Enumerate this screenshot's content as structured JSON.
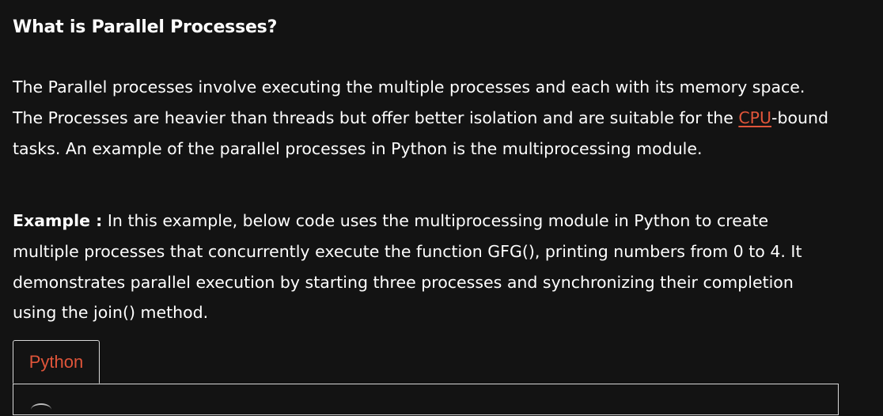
{
  "article": {
    "heading": "What is Parallel Processes?",
    "paragraph1": {
      "before_link": "The Parallel processes involve executing the multiple processes and each with its memory space. The Processes are heavier than threads but offer better isolation and are suitable for the ",
      "link_text": "CPU",
      "after_link": "-bound tasks. An example of the parallel processes in Python is the multiprocessing module."
    },
    "paragraph2": {
      "label": "Example :",
      "text": " In this example, below code uses the multiprocessing module in Python to create multiple processes that concurrently execute the function GFG(), printing numbers from 0 to 4. It demonstrates parallel execution by starting three processes and synchronizing their completion using the join() method."
    }
  },
  "code_tabs": {
    "tabs": [
      "Python"
    ],
    "active_tab": "Python"
  },
  "colors": {
    "background": "#131313",
    "text": "#ffffff",
    "accent": "#e0553a",
    "border": "#d8d8d8"
  }
}
